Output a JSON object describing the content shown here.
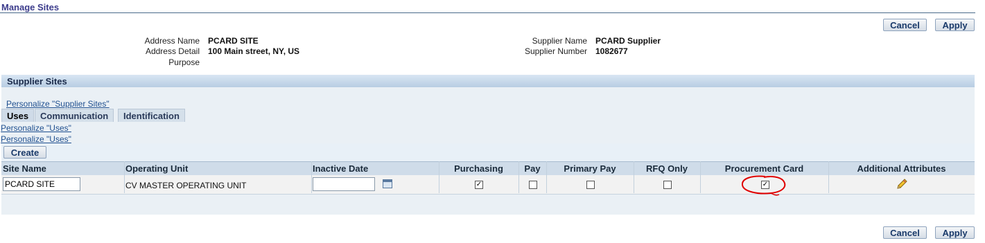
{
  "page": {
    "title": "Manage Sites"
  },
  "buttons": {
    "cancel": "Cancel",
    "apply": "Apply",
    "create": "Create"
  },
  "address": {
    "name_label": "Address Name",
    "name_value": "PCARD SITE",
    "detail_label": "Address Detail",
    "detail_value": "100 Main street, NY, US",
    "purpose_label": "Purpose",
    "purpose_value": ""
  },
  "supplier": {
    "name_label": "Supplier Name",
    "name_value": "PCARD Supplier",
    "number_label": "Supplier Number",
    "number_value": "1082677"
  },
  "section": {
    "title": "Supplier Sites",
    "personalize_sites": "Personalize \"Supplier Sites\"",
    "personalize_uses_1": "Personalize \"Uses\"",
    "personalize_uses_2": "Personalize \"Uses\""
  },
  "tabs": [
    {
      "label": "Uses",
      "active": true
    },
    {
      "label": "Communication",
      "active": false
    },
    {
      "label": "Identification",
      "active": false
    }
  ],
  "table": {
    "columns": [
      "Site Name",
      "Operating Unit",
      "Inactive Date",
      "Purchasing",
      "Pay",
      "Primary Pay",
      "RFQ Only",
      "Procurement Card",
      "Additional Attributes"
    ],
    "rows": [
      {
        "site_name": "PCARD SITE",
        "operating_unit": "CV MASTER OPERATING UNIT",
        "inactive_date": "",
        "purchasing": true,
        "pay": false,
        "primary_pay": false,
        "rfq_only": false,
        "procurement_card": true
      }
    ]
  },
  "icons": {
    "calendar": "calendar-icon",
    "edit": "pencil-icon"
  },
  "colors": {
    "header_blue": "#b7cde3",
    "link": "#1f4f8f",
    "annotation": "#e00000"
  }
}
